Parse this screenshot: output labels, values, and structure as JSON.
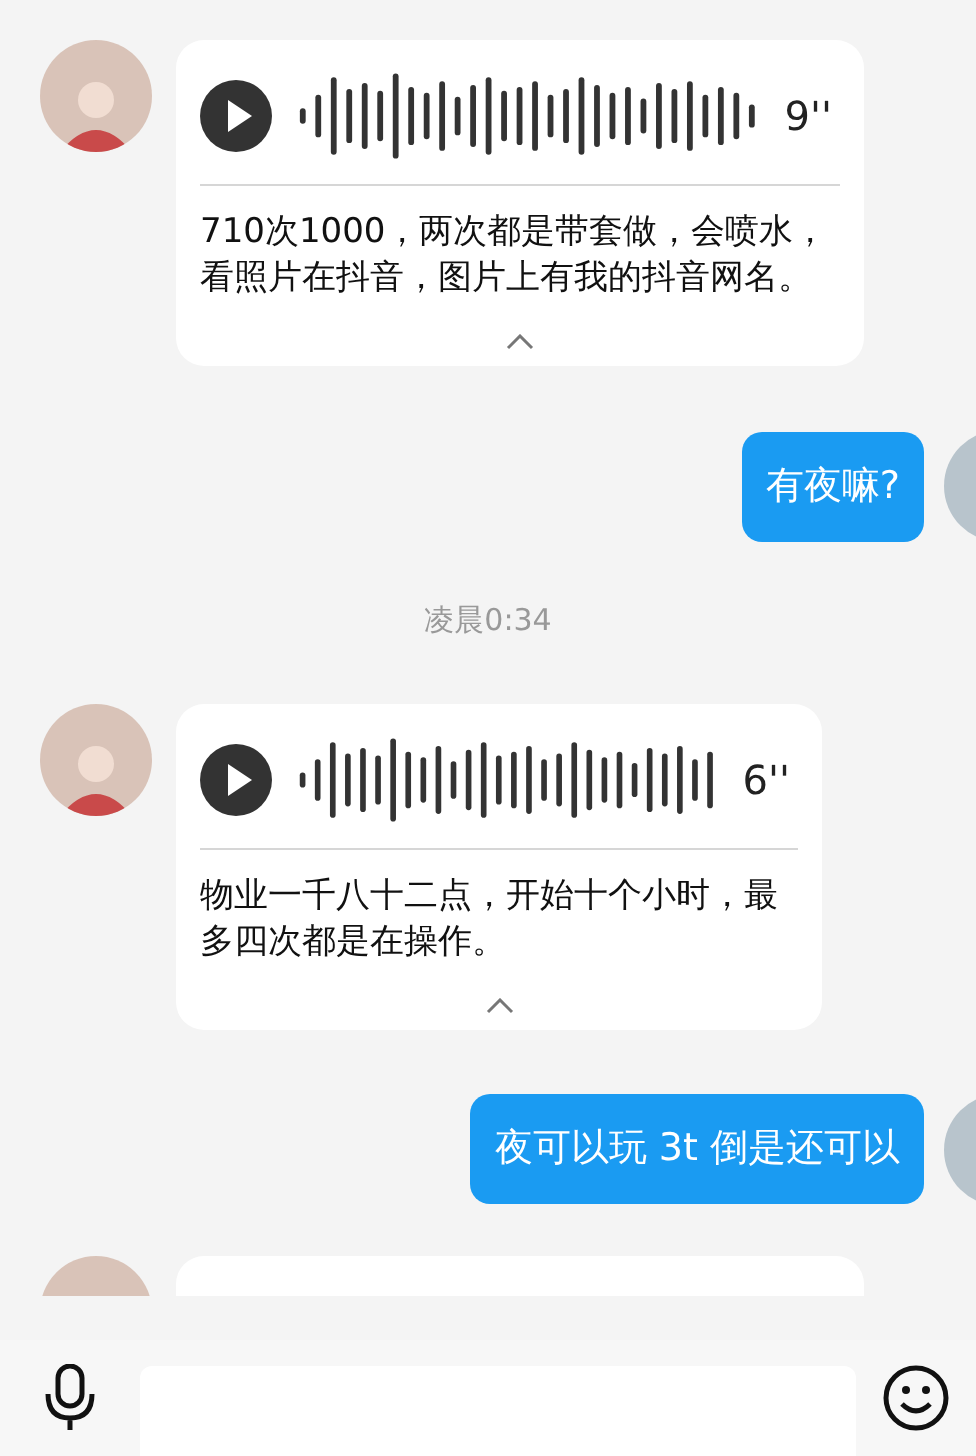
{
  "messages": [
    {
      "kind": "voice",
      "duration": "9''",
      "transcript": "710次1000，两次都是带套做，会喷水，看照片在抖音，图片上有我的抖音网名。"
    },
    {
      "kind": "text",
      "text": "有夜嘛?"
    },
    {
      "kind": "time",
      "text": "凌晨0:34"
    },
    {
      "kind": "voice",
      "duration": "6''",
      "transcript": "物业一千八十二点，开始十个小时，最多四次都是在操作。"
    },
    {
      "kind": "text",
      "text": "夜可以玩 3t 倒是还可以"
    },
    {
      "kind": "voice_partial"
    }
  ]
}
